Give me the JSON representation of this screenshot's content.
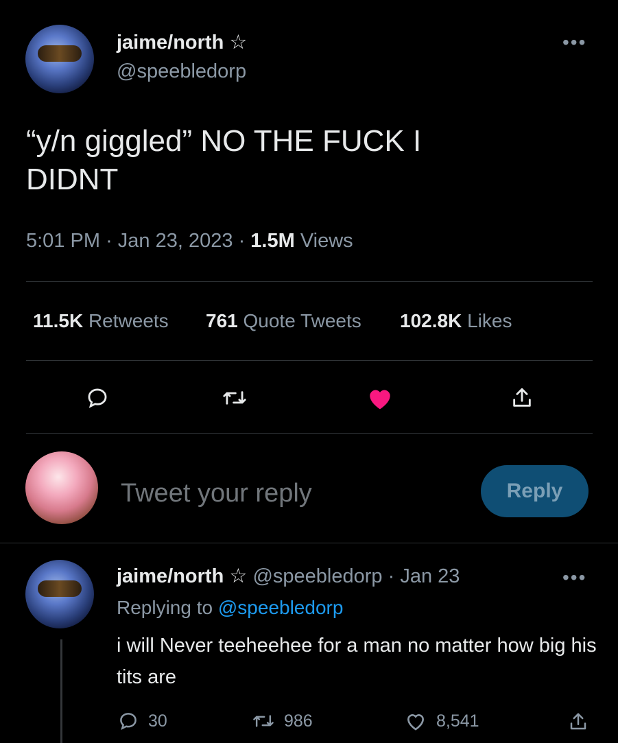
{
  "tweet": {
    "author_name": "jaime/north",
    "star_glyph": "☆",
    "author_handle": "@speebledorp",
    "more_label": "•••",
    "text_line1": "“y/n giggled” NO THE FUCK I",
    "text_line2": "DIDNT",
    "time": "5:01 PM",
    "date": "Jan 23, 2023",
    "views_count": "1.5M",
    "views_label": "Views",
    "separator": "·",
    "stats": {
      "retweets_count": "11.5K",
      "retweets_label": "Retweets",
      "quotes_count": "761",
      "quotes_label": "Quote Tweets",
      "likes_count": "102.8K",
      "likes_label": "Likes"
    },
    "actions": {
      "reply_icon": "reply-icon",
      "retweet_icon": "retweet-icon",
      "like_icon": "heart-filled-icon",
      "like_color": "#f91880",
      "share_icon": "share-icon"
    }
  },
  "compose": {
    "placeholder": "Tweet your reply",
    "button_label": "Reply",
    "button_color": "#0f4e74"
  },
  "reply": {
    "author_name": "jaime/north",
    "star_glyph": "☆",
    "author_handle": "@speebledorp",
    "date": "Jan 23",
    "separator": "·",
    "more_label": "•••",
    "replying_prefix": "Replying to",
    "replying_handle": "@speebledorp",
    "text": "i will Never teeheehee for a man no matter how big his tits are",
    "reply_count": "30",
    "retweet_count": "986",
    "like_count": "8,541"
  }
}
